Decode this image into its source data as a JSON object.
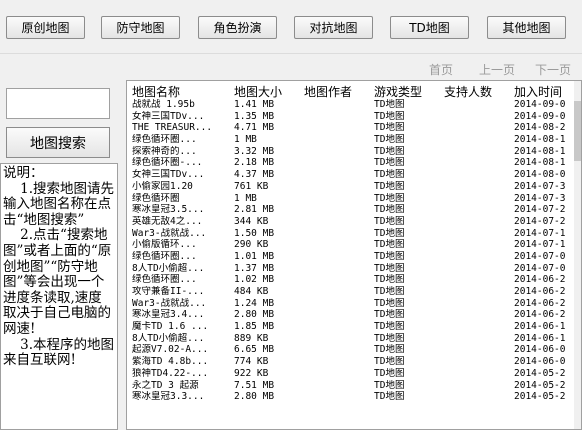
{
  "toolbar": {
    "buttons": [
      "原创地图",
      "防守地图",
      "角色扮演",
      "对抗地图",
      "TD地图",
      "其他地图"
    ]
  },
  "pager": {
    "first": "首页",
    "prev": "上一页",
    "next": "下一页"
  },
  "search": {
    "value": "",
    "button_label": "地图搜索"
  },
  "help": {
    "text": "说明：\n    1.搜索地图请先输入地图名称在点击“地图搜索”\n    2.点击“搜索地图”或者上面的“原创地图”“防守地图”等会出现一个进度条读取,速度取决于自己电脑的网速!\n    3.本程序的地图来自互联网!"
  },
  "table": {
    "headers": [
      "地图名称",
      "地图大小",
      "地图作者",
      "游戏类型",
      "支持人数",
      "加入时间"
    ],
    "rows": [
      [
        "战就战 1.95b",
        "1.41 MB",
        "",
        "TD地图",
        "",
        "2014-09-0"
      ],
      [
        "女神三国TDv...",
        "1.35 MB",
        "",
        "TD地图",
        "",
        "2014-09-0"
      ],
      [
        "THE TREASUR...",
        "4.71 MB",
        "",
        "TD地图",
        "",
        "2014-08-2"
      ],
      [
        "绿色循环圈...",
        "1 MB",
        "",
        "TD地图",
        "",
        "2014-08-1"
      ],
      [
        "探索神奇的...",
        "3.32 MB",
        "",
        "TD地图",
        "",
        "2014-08-1"
      ],
      [
        "绿色循环圈-...",
        "2.18 MB",
        "",
        "TD地图",
        "",
        "2014-08-1"
      ],
      [
        "女神三国TDv...",
        "4.37 MB",
        "",
        "TD地图",
        "",
        "2014-08-0"
      ],
      [
        "小偷家园1.20",
        "761 KB",
        "",
        "TD地图",
        "",
        "2014-07-3"
      ],
      [
        "绿色循环圈",
        "1 MB",
        "",
        "TD地图",
        "",
        "2014-07-3"
      ],
      [
        "寒冰皇冠3.5...",
        "2.81 MB",
        "",
        "TD地图",
        "",
        "2014-07-2"
      ],
      [
        "英雄无敌4之...",
        "344 KB",
        "",
        "TD地图",
        "",
        "2014-07-2"
      ],
      [
        "War3-战就战...",
        "1.50 MB",
        "",
        "TD地图",
        "",
        "2014-07-1"
      ],
      [
        "小偷版循环...",
        "290 KB",
        "",
        "TD地图",
        "",
        "2014-07-1"
      ],
      [
        "绿色循环圈...",
        "1.01 MB",
        "",
        "TD地图",
        "",
        "2014-07-0"
      ],
      [
        "8人TD小偷超...",
        "1.37 MB",
        "",
        "TD地图",
        "",
        "2014-07-0"
      ],
      [
        "绿色循环圈...",
        "1.02 MB",
        "",
        "TD地图",
        "",
        "2014-06-2"
      ],
      [
        "攻守兼备II-...",
        "484 KB",
        "",
        "TD地图",
        "",
        "2014-06-2"
      ],
      [
        "War3-战就战...",
        "1.24 MB",
        "",
        "TD地图",
        "",
        "2014-06-2"
      ],
      [
        "寒冰皇冠3.4...",
        "2.80 MB",
        "",
        "TD地图",
        "",
        "2014-06-2"
      ],
      [
        "魔卡TD 1.6 ...",
        "1.85 MB",
        "",
        "TD地图",
        "",
        "2014-06-1"
      ],
      [
        "8人TD小偷超...",
        "889 KB",
        "",
        "TD地图",
        "",
        "2014-06-1"
      ],
      [
        "起源V7.02-A...",
        "6.65 MB",
        "",
        "TD地图",
        "",
        "2014-06-0"
      ],
      [
        "紫海TD 4.8b...",
        "774 KB",
        "",
        "TD地图",
        "",
        "2014-06-0"
      ],
      [
        "狼神TD4.22-...",
        "922 KB",
        "",
        "TD地图",
        "",
        "2014-05-2"
      ],
      [
        "永之TD 3 起源",
        "7.51 MB",
        "",
        "TD地图",
        "",
        "2014-05-2"
      ],
      [
        "寒冰皇冠3.3...",
        "2.80 MB",
        "",
        "TD地图",
        "",
        "2014-05-2"
      ]
    ]
  }
}
